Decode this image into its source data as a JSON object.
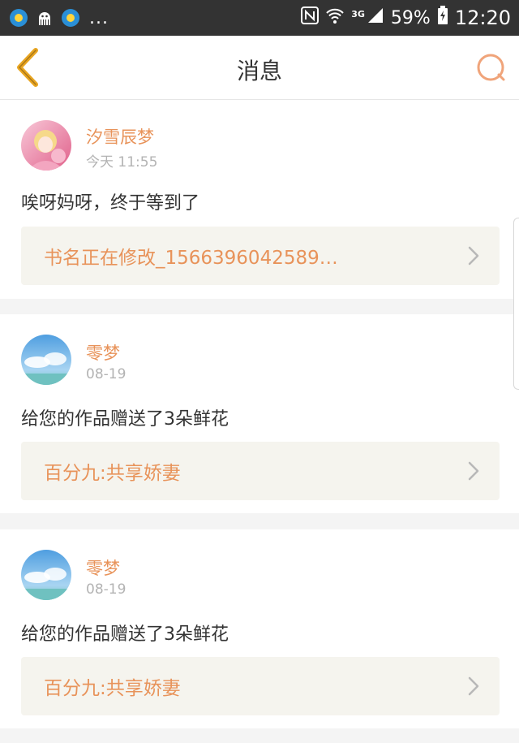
{
  "status_bar": {
    "left_icons": [
      "weather-sun-icon",
      "octopus-icon",
      "weather-sun-icon"
    ],
    "more": "...",
    "battery": "59%",
    "time": "12:20",
    "network": "3G"
  },
  "header": {
    "title": "消息",
    "back_icon": "chevron-left-icon",
    "search_icon": "search-icon"
  },
  "colors": {
    "accent": "#e8935a",
    "back_icon": "#e8a521",
    "search_icon": "#f0a47a",
    "link_bg": "#f5f4ee"
  },
  "messages": [
    {
      "user": "汐雪辰梦",
      "time": "今天 11:55",
      "text": "唉呀妈呀，终于等到了",
      "book": "书名正在修改_1566396042589…",
      "avatar": "anime-girl-avatar"
    },
    {
      "user": "零梦",
      "time": "08-19",
      "text": "给您的作品赠送了3朵鲜花",
      "book": "百分九:共享娇妻",
      "avatar": "sky-clouds-avatar"
    },
    {
      "user": "零梦",
      "time": "08-19",
      "text": "给您的作品赠送了3朵鲜花",
      "book": "百分九:共享娇妻",
      "avatar": "sky-clouds-avatar"
    }
  ]
}
